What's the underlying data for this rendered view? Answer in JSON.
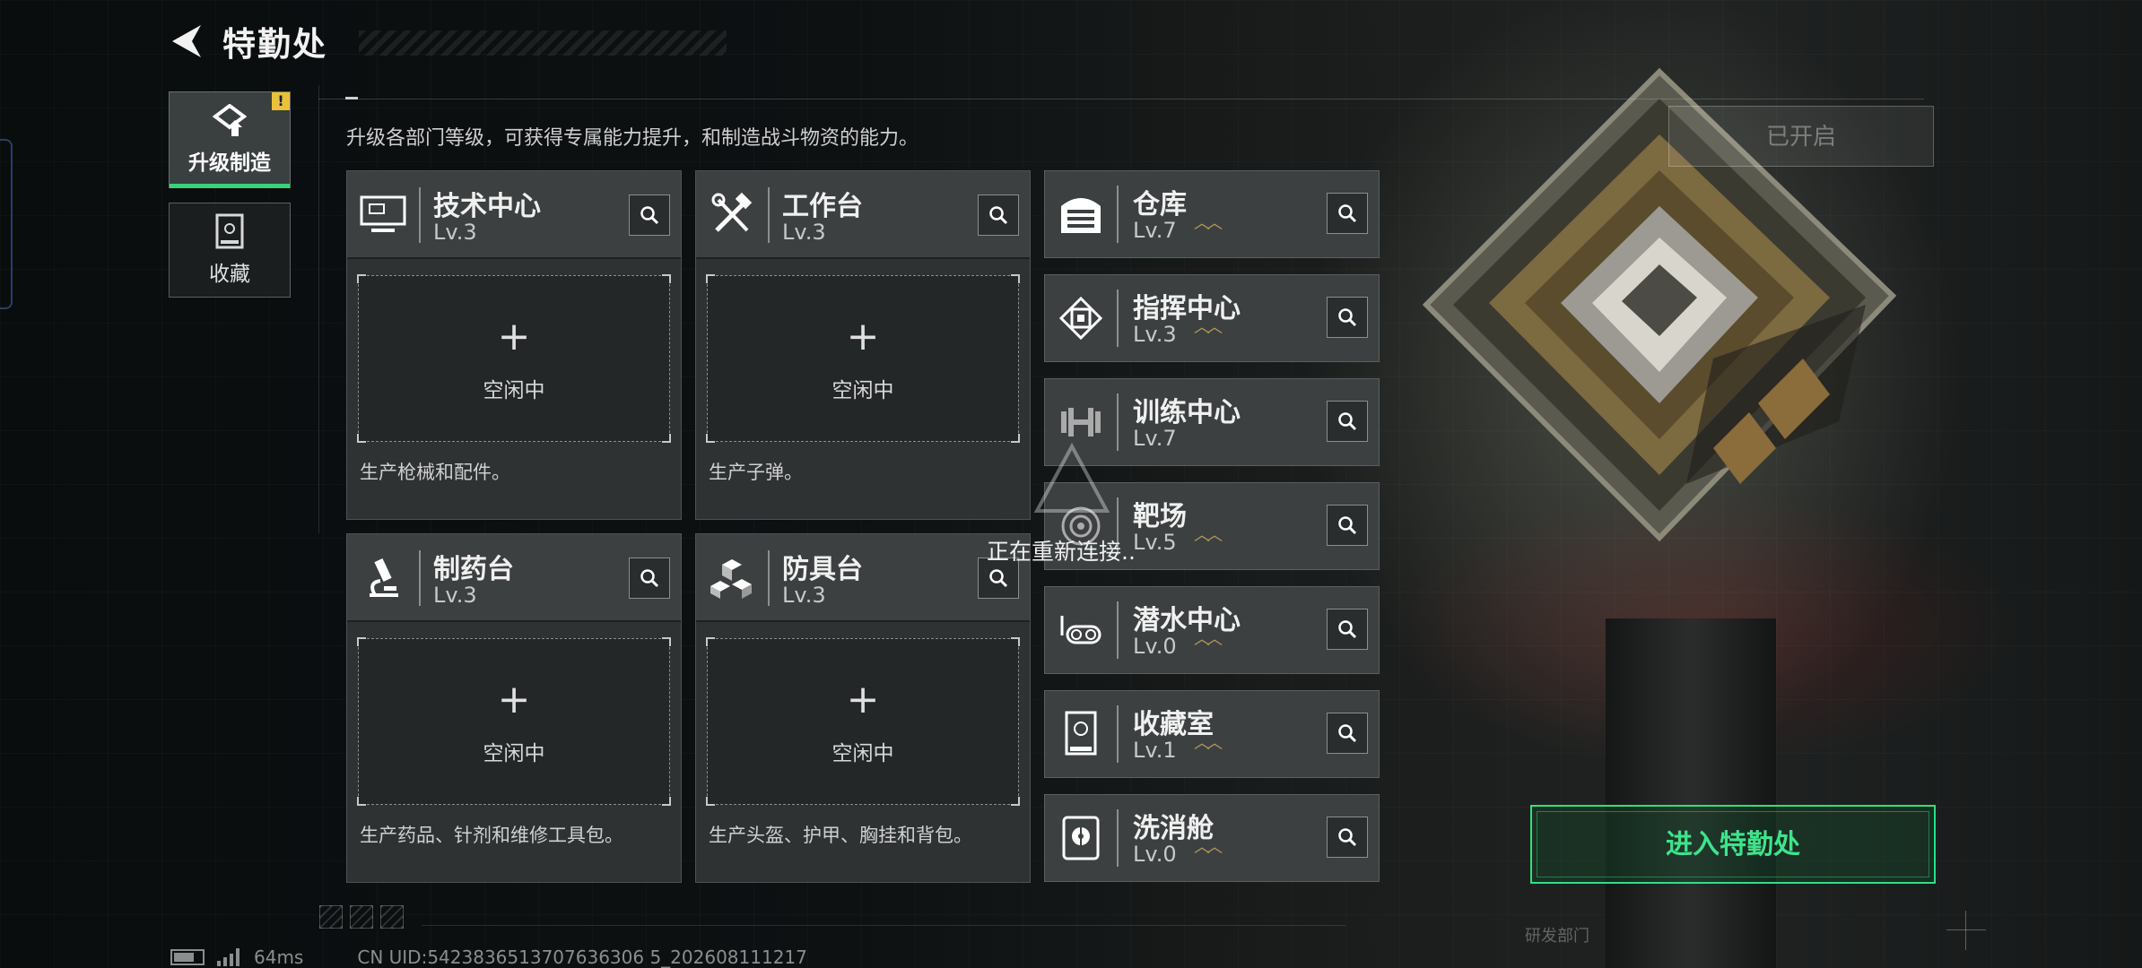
{
  "header": {
    "title": "特勤处"
  },
  "description": "升级各部门等级，可获得专属能力提升，和制造战斗物资的能力。",
  "tabs": [
    {
      "label": "升级制造",
      "active": true,
      "badge": "!"
    },
    {
      "label": "收藏",
      "active": false
    }
  ],
  "stations": [
    {
      "name": "技术中心",
      "level": "Lv.3",
      "slot_plus": "+",
      "slot_status": "空闲中",
      "desc": "生产枪械和配件。",
      "icon": "computer-icon"
    },
    {
      "name": "工作台",
      "level": "Lv.3",
      "slot_plus": "+",
      "slot_status": "空闲中",
      "desc": "生产子弹。",
      "icon": "tools-icon"
    },
    {
      "name": "制药台",
      "level": "Lv.3",
      "slot_plus": "+",
      "slot_status": "空闲中",
      "desc": "生产药品、针剂和维修工具包。",
      "icon": "microscope-icon"
    },
    {
      "name": "防具台",
      "level": "Lv.3",
      "slot_plus": "+",
      "slot_status": "空闲中",
      "desc": "生产头盔、护甲、胸挂和背包。",
      "icon": "armor-blocks-icon"
    }
  ],
  "facilities": [
    {
      "name": "仓库",
      "level": "Lv.7",
      "upgradable": true,
      "icon": "warehouse-icon"
    },
    {
      "name": "指挥中心",
      "level": "Lv.3",
      "upgradable": true,
      "icon": "command-chip-icon"
    },
    {
      "name": "训练中心",
      "level": "Lv.7",
      "upgradable": false,
      "icon": "dumbbell-icon"
    },
    {
      "name": "靶场",
      "level": "Lv.5",
      "upgradable": true,
      "icon": "target-icon"
    },
    {
      "name": "潜水中心",
      "level": "Lv.0",
      "upgradable": true,
      "icon": "diving-mask-icon"
    },
    {
      "name": "收藏室",
      "level": "Lv.1",
      "upgradable": true,
      "icon": "display-case-icon"
    },
    {
      "name": "洗消舱",
      "level": "Lv.0",
      "upgradable": true,
      "icon": "radiation-icon"
    }
  ],
  "upgrade_arrows": "︿︿",
  "overlay": {
    "reconnecting": "正在重新连接.."
  },
  "opened_label": "已开启",
  "enter_button": "进入特勤处",
  "status_bar": {
    "ping": "64ms",
    "uid": "CN UID:5423836513707636306 5_202608111217"
  },
  "studio_label": "研发部门",
  "colors": {
    "accent_green": "#38d27a",
    "badge_yellow": "#e8c23a",
    "upgrade_gold": "#b39a5a"
  }
}
